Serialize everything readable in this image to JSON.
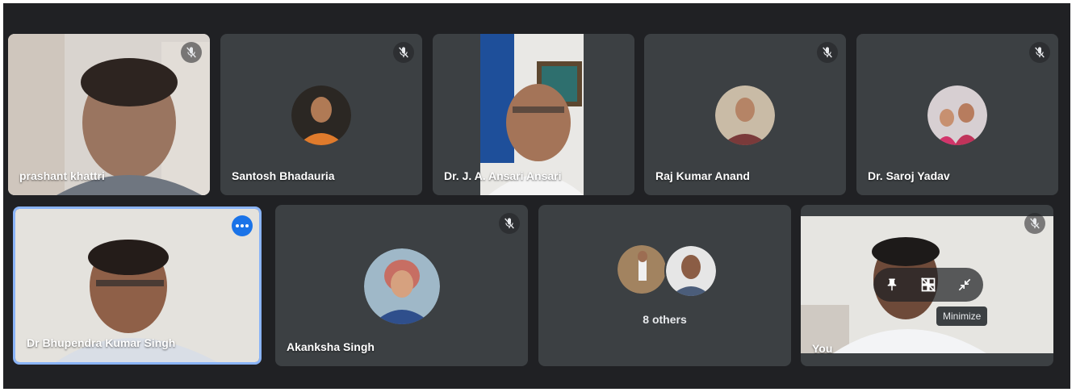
{
  "participants": [
    {
      "name": "prashant khattri",
      "muted": true,
      "mode": "video"
    },
    {
      "name": "Santosh Bhadauria",
      "muted": true,
      "mode": "avatar"
    },
    {
      "name": "Dr. J. A. Ansari Ansari",
      "muted": false,
      "mode": "video"
    },
    {
      "name": "Raj Kumar Anand",
      "muted": true,
      "mode": "avatar"
    },
    {
      "name": "Dr. Saroj Yadav",
      "muted": true,
      "mode": "avatar"
    },
    {
      "name": "Dr Bhupendra Kumar Singh",
      "muted": false,
      "mode": "video",
      "highlighted": true
    },
    {
      "name": "Akanksha Singh",
      "muted": true,
      "mode": "avatar"
    },
    {
      "name": "You",
      "muted": true,
      "mode": "video"
    }
  ],
  "others": {
    "label": "8 others"
  },
  "self_tile": {
    "tooltip": "Minimize",
    "controls": [
      "pin-icon",
      "hide-self-icon",
      "minimize-icon"
    ]
  },
  "colors": {
    "background": "#202124",
    "tile": "#3c4043",
    "accent": "#1a73e8",
    "text": "#ffffff"
  }
}
